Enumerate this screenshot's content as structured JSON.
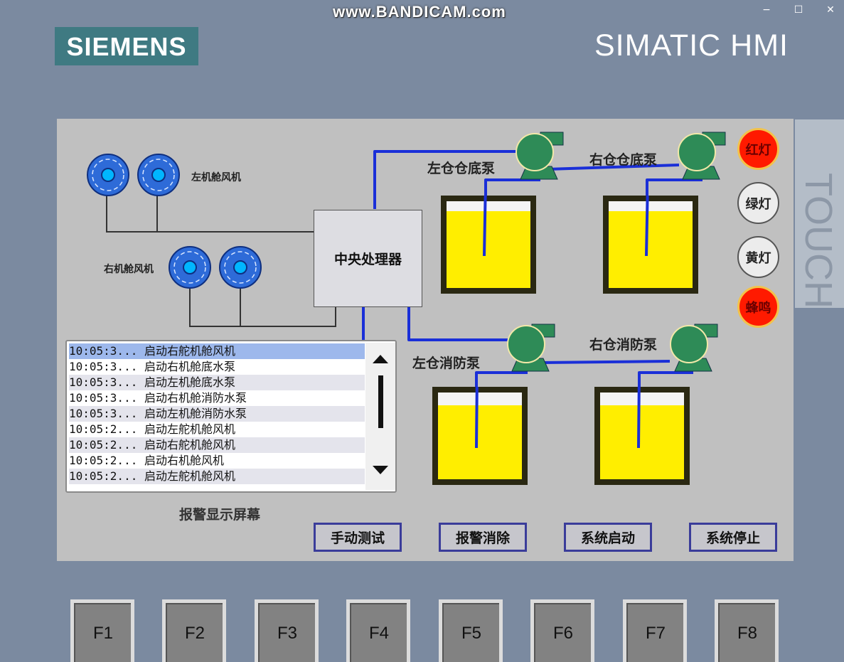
{
  "window": {
    "watermark": "www.BANDICAM.com",
    "minimize": "−",
    "maximize": "☐",
    "close": "✕"
  },
  "header": {
    "logo": "SIEMENS",
    "product": "SIMATIC HMI",
    "touch_label": "TOUCH",
    "brand_color": "#3f7a82"
  },
  "fans": {
    "left_label": "左机舱风机",
    "right_label": "右机舱风机",
    "fan_color": "#2e6bd8"
  },
  "cpu": {
    "label": "中央处理器"
  },
  "pumps": {
    "left_bilge": "左仓仓底泵",
    "right_bilge": "右仓仓底泵",
    "left_fire": "左仓消防泵",
    "right_fire": "右仓消防泵",
    "pump_color": "#2e8b57",
    "pipe_color": "#1a2fd8"
  },
  "tanks": {
    "liquid_color": "#ffee00"
  },
  "lamps": [
    {
      "label": "红灯",
      "state": "on"
    },
    {
      "label": "绿灯",
      "state": "off"
    },
    {
      "label": "黄灯",
      "state": "off"
    },
    {
      "label": "蜂鸣",
      "state": "on"
    }
  ],
  "alarms": {
    "caption": "报警显示屏幕",
    "rows": [
      "10:05:3... 启动右舵机舱风机",
      "10:05:3... 启动右机舱底水泵",
      "10:05:3... 启动左机舱底水泵",
      "10:05:3... 启动右机舱消防水泵",
      "10:05:3... 启动左机舱消防水泵",
      "10:05:2... 启动左舵机舱风机",
      "10:05:2... 启动右舵机舱风机",
      "10:05:2... 启动右机舱风机",
      "10:05:2... 启动左舵机舱风机"
    ]
  },
  "buttons": {
    "manual_test": "手动测试",
    "alarm_clear": "报警消除",
    "system_start": "系统启动",
    "system_stop": "系统停止"
  },
  "fkeys": [
    "F1",
    "F2",
    "F3",
    "F4",
    "F5",
    "F6",
    "F7",
    "F8"
  ]
}
